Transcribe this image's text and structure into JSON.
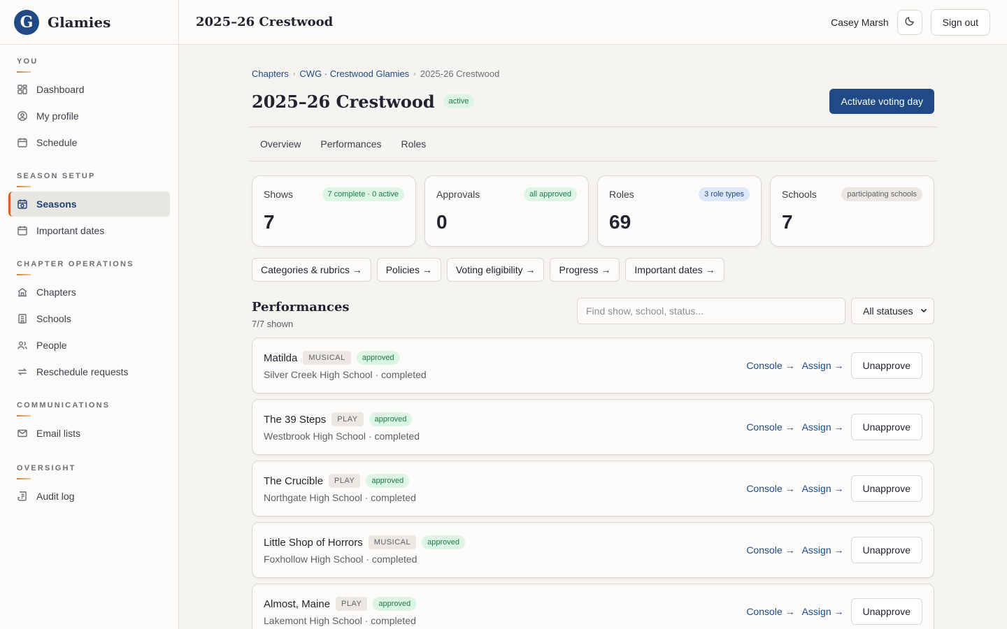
{
  "app": {
    "name": "Glamies",
    "logo_letter": "G"
  },
  "topbar": {
    "title": "2025–26 Crestwood",
    "user": "Casey Marsh",
    "theme_icon": "moon-icon",
    "sign_out": "Sign out"
  },
  "sidebar": {
    "sections": [
      {
        "heading": "YOU",
        "items": [
          {
            "label": "Dashboard",
            "icon": "dashboard-icon"
          },
          {
            "label": "My profile",
            "icon": "profile-icon"
          },
          {
            "label": "Schedule",
            "icon": "calendar-icon"
          }
        ]
      },
      {
        "heading": "SEASON SETUP",
        "items": [
          {
            "label": "Seasons",
            "icon": "season-calendar-icon",
            "active": true
          },
          {
            "label": "Important dates",
            "icon": "calendar-icon"
          }
        ]
      },
      {
        "heading": "CHAPTER OPERATIONS",
        "items": [
          {
            "label": "Chapters",
            "icon": "chapters-icon"
          },
          {
            "label": "Schools",
            "icon": "school-icon"
          },
          {
            "label": "People",
            "icon": "people-icon"
          },
          {
            "label": "Reschedule requests",
            "icon": "swap-icon"
          }
        ]
      },
      {
        "heading": "COMMUNICATIONS",
        "items": [
          {
            "label": "Email lists",
            "icon": "mail-icon"
          }
        ]
      },
      {
        "heading": "OVERSIGHT",
        "items": [
          {
            "label": "Audit log",
            "icon": "audit-log-icon"
          }
        ]
      }
    ]
  },
  "breadcrumbs": [
    "Chapters",
    "CWG · Crestwood Glamies",
    "2025-26 Crestwood"
  ],
  "page": {
    "title": "2025–26 Crestwood",
    "status": "active",
    "primary_action": "Activate voting day"
  },
  "tabs": [
    "Overview",
    "Performances",
    "Roles"
  ],
  "stats": [
    {
      "label": "Shows",
      "badge": "7 complete · 0 active",
      "badge_style": "green",
      "value": "7"
    },
    {
      "label": "Approvals",
      "badge": "all approved",
      "badge_style": "green",
      "value": "0"
    },
    {
      "label": "Roles",
      "badge": "3 role types",
      "badge_style": "blue",
      "value": "69"
    },
    {
      "label": "Schools",
      "badge": "participating schools",
      "badge_style": "gray",
      "value": "7"
    }
  ],
  "quick_links": [
    "Categories & rubrics →",
    "Policies →",
    "Voting eligibility →",
    "Progress →",
    "Important dates →"
  ],
  "performances": {
    "title": "Performances",
    "shown": "7/7 shown",
    "search_placeholder": "Find show, school, status...",
    "status_filter": "All statuses",
    "console_label": "Console →",
    "assign_label": "Assign →",
    "unapprove_label": "Unapprove",
    "items": [
      {
        "name": "Matilda",
        "type": "MUSICAL",
        "status": "approved",
        "school": "Silver Creek High School · completed"
      },
      {
        "name": "The 39 Steps",
        "type": "PLAY",
        "status": "approved",
        "school": "Westbrook High School · completed"
      },
      {
        "name": "The Crucible",
        "type": "PLAY",
        "status": "approved",
        "school": "Northgate High School · completed"
      },
      {
        "name": "Little Shop of Horrors",
        "type": "MUSICAL",
        "status": "approved",
        "school": "Foxhollow High School · completed"
      },
      {
        "name": "Almost, Maine",
        "type": "PLAY",
        "status": "approved",
        "school": "Lakemont High School · completed"
      }
    ]
  }
}
